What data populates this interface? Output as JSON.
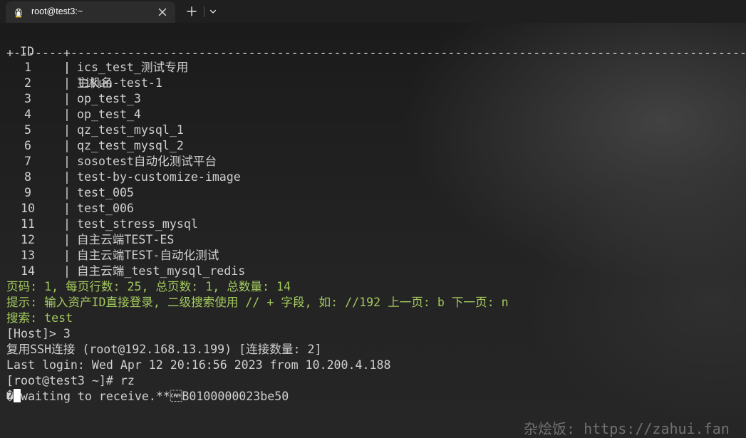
{
  "tab": {
    "title": "root@test3:~",
    "icon": "linux-penguin-icon"
  },
  "terminal": {
    "header_id": "ID",
    "header_pipe": "|",
    "header_name": "主机名",
    "separator": "+-------+---------------------------------------------------------------------------------------------------------------------------",
    "rows": [
      {
        "id": "1",
        "name": "ics_test_测试专用"
      },
      {
        "id": "2",
        "name": "likun-test-1"
      },
      {
        "id": "3",
        "name": "op_test_3"
      },
      {
        "id": "4",
        "name": "op_test_4"
      },
      {
        "id": "5",
        "name": "qz_test_mysql_1"
      },
      {
        "id": "6",
        "name": "qz_test_mysql_2"
      },
      {
        "id": "7",
        "name": "sosotest自动化测试平台"
      },
      {
        "id": "8",
        "name": "test-by-customize-image"
      },
      {
        "id": "9",
        "name": "test_005"
      },
      {
        "id": "10",
        "name": "test_006"
      },
      {
        "id": "11",
        "name": "test_stress_mysql"
      },
      {
        "id": "12",
        "name": "自主云端TEST-ES"
      },
      {
        "id": "13",
        "name": "自主云端TEST-自动化测试"
      },
      {
        "id": "14",
        "name": "自主云端_test_mysql_redis"
      }
    ],
    "pagination": "页码: 1, 每页行数: 25, 总页数: 1, 总数量: 14",
    "hint": "提示: 输入资产ID直接登录, 二级搜索使用 // + 字段, 如: //192 上一页: b 下一页: n",
    "search": "搜索: test",
    "host_prompt": "[Host]> 3",
    "reuse_ssh": "复用SSH连接 (root@192.168.13.199) [连接数量: 2]",
    "last_login": "Last login: Wed Apr 12 20:16:56 2023 from 10.200.4.188",
    "shell_prompt": "[root@test3 ~]# rz",
    "rz_prefix": "�",
    "rz_output": "waiting to receive.**\u0018B0100000023be50"
  },
  "watermark": "杂烩饭: https://zahui.fan",
  "colors": {
    "accent_green": "#a3c95e",
    "text": "#d0d0d0",
    "background": "#0c0c0c",
    "tab_active": "#2c2c2c"
  }
}
